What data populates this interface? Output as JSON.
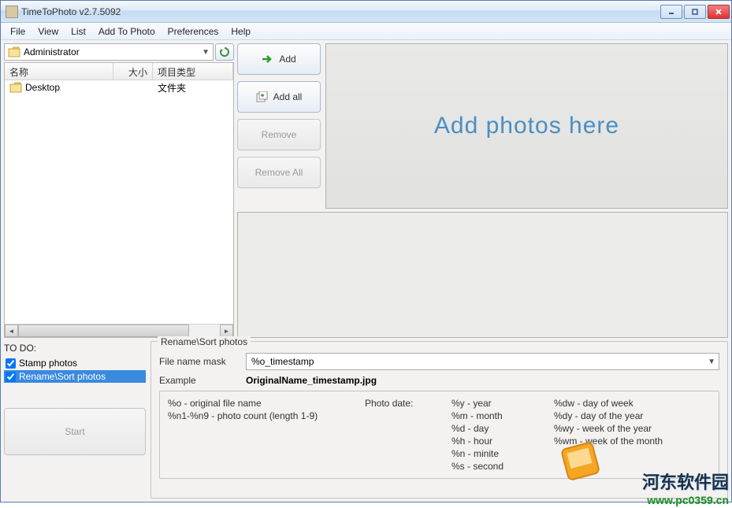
{
  "title": "TimeToPhoto v2.7.5092",
  "menu": {
    "file": "File",
    "view": "View",
    "list": "List",
    "addToPhoto": "Add To Photo",
    "preferences": "Preferences",
    "help": "Help"
  },
  "path": {
    "current": "Administrator"
  },
  "columns": {
    "name": "名称",
    "size": "大小",
    "type": "项目类型"
  },
  "rows": [
    {
      "name": "Desktop",
      "size": "",
      "type": "文件夹"
    }
  ],
  "buttons": {
    "add": "Add",
    "addAll": "Add all",
    "remove": "Remove",
    "removeAll": "Remove All"
  },
  "preview": {
    "placeholder": "Add photos here"
  },
  "todo": {
    "heading": "TO DO:",
    "items": [
      {
        "label": "Stamp photos",
        "checked": true,
        "selected": false
      },
      {
        "label": "Rename\\Sort photos",
        "checked": true,
        "selected": true
      }
    ],
    "start": "Start"
  },
  "rename": {
    "legend": "Rename\\Sort photos",
    "maskLabel": "File name mask",
    "maskValue": "%o_timestamp",
    "exampleLabel": "Example",
    "exampleValue": "OriginalName_timestamp.jpg",
    "help": {
      "col1": [
        "%o - original file name",
        "%n1-%n9 - photo count (length  1-9)"
      ],
      "photoHeader": "Photo date:",
      "col2": [
        "%y - year",
        "%m - month",
        "%d - day",
        "%h - hour",
        "%n - minite",
        "%s - second"
      ],
      "col3": [
        "%dw - day of week",
        "%dy - day of the year",
        "%wy - week of the year",
        "%wm - week of the month"
      ]
    }
  },
  "watermark": {
    "text": "河东软件园",
    "url": "www.pc0359.cn"
  }
}
